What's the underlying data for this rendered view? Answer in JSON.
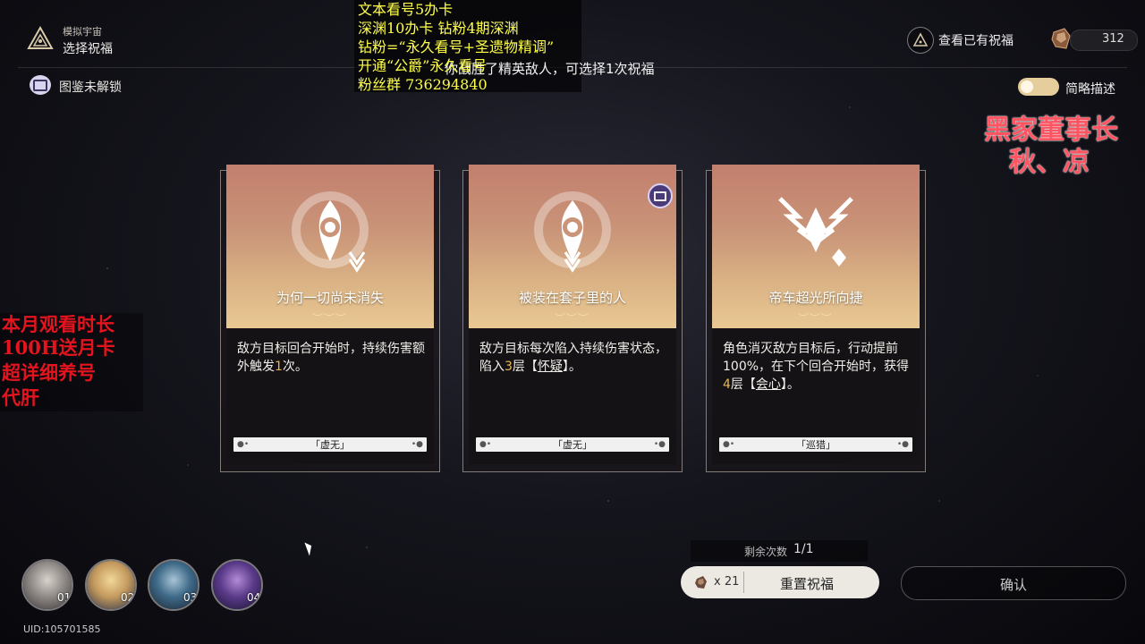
{
  "header": {
    "mode_small": "模拟宇宙",
    "mode_title": "选择祝福",
    "atlas_label": "图鉴未解锁",
    "hint": "你战胜了精英敌人，可选择1次祝福",
    "view_blessings": "查看已有祝福",
    "currency_value": "312",
    "toggle_label": "简略描述"
  },
  "overlay": {
    "lines": [
      "文本看号5办卡",
      "深渊10办卡 钻粉4期深渊",
      "钻粉=“永久看号+圣遗物精调”",
      "开通“公爵”永久看号",
      "粉丝群 736294840"
    ],
    "streamer_line1": "黑家董事长",
    "streamer_line2": "秋、凉",
    "promo": [
      "本月观看时长",
      "100H送月卡",
      "超详细养号",
      "代肝"
    ]
  },
  "cards": [
    {
      "name": "为何一切尚未消失",
      "desc_a": "敌方目标回合开始时，持续伤害额外触发",
      "desc_hl": "1",
      "desc_b": "次。",
      "path": "「虚无」",
      "has_badge": false
    },
    {
      "name": "被装在套子里的人",
      "desc_a": "敌方目标每次陷入持续伤害状态，陷入",
      "desc_hl": "3",
      "desc_b": "层【",
      "desc_u": "怀疑",
      "desc_c": "】。",
      "path": "「虚无」",
      "has_badge": true
    },
    {
      "name": "帝车超光所向捷",
      "desc_a": "角色消灭敌方目标后，行动提前100%，在下个回合开始时，获得",
      "desc_hl": "4",
      "desc_b": "层【",
      "desc_u": "会心",
      "desc_c": "】。",
      "path": "「巡猎」",
      "has_badge": false
    }
  ],
  "bottom": {
    "remaining_label": "剩余次数",
    "remaining_value": "1/1",
    "reset_cost": "x 21",
    "reset_label": "重置祝福",
    "confirm_label": "确认",
    "uid": "UID:105701585"
  },
  "party": [
    "01",
    "02",
    "03",
    "04"
  ]
}
